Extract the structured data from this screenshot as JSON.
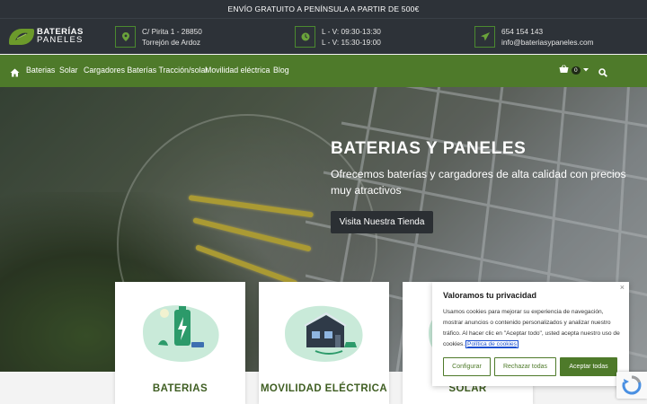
{
  "announcement": "ENVÍO GRATUITO A PENÍNSULA A PARTIR DE 500€",
  "logo": {
    "line1": "BATERÍAS",
    "line2": "PANELES"
  },
  "info": {
    "address": {
      "line1": "C/ Pirita 1 - 28850",
      "line2": "Torrejón de Ardoz",
      "icon": "map-marker-icon"
    },
    "hours": {
      "line1": "L - V: 09:30-13:30",
      "line2": "L - V: 15:30-19:00",
      "icon": "clock-icon"
    },
    "contact": {
      "line1": "654 154 143",
      "line2": "info@bateriasypaneles.com",
      "icon": "paper-plane-icon"
    }
  },
  "nav": {
    "items": [
      {
        "label": "Baterias"
      },
      {
        "label": "Solar"
      },
      {
        "label": "Cargadores Baterías Tracción/solar"
      },
      {
        "label": "Movilidad eléctrica"
      },
      {
        "label": "Blog"
      }
    ],
    "cart_count": "0"
  },
  "hero": {
    "title": "BATERIAS Y PANELES",
    "subtitle": "Ofrecemos baterías y cargadores de alta calidad con precios muy atractivos",
    "cta": "Visita Nuestra Tienda"
  },
  "cards": [
    {
      "title": "BATERIAS"
    },
    {
      "title": "MOVILIDAD ELÉCTRICA"
    },
    {
      "title": "SOLAR"
    }
  ],
  "cookie": {
    "title": "Valoramos tu privacidad",
    "text": "Usamos cookies para mejorar su experiencia de navegación, mostrar anuncios o contenido personalizados y analizar nuestro tráfico. Al hacer clic en \"Aceptar todo\", usted acepta nuestro uso de cookies.",
    "link": "Política de cookies",
    "close": "×",
    "btn_configure": "Configurar",
    "btn_reject": "Rechazar todas",
    "btn_accept": "Aceptar todas"
  },
  "colors": {
    "brand_green": "#4e7a2a",
    "dark": "#2d3238",
    "accent_yellow": "#d9c23a"
  }
}
